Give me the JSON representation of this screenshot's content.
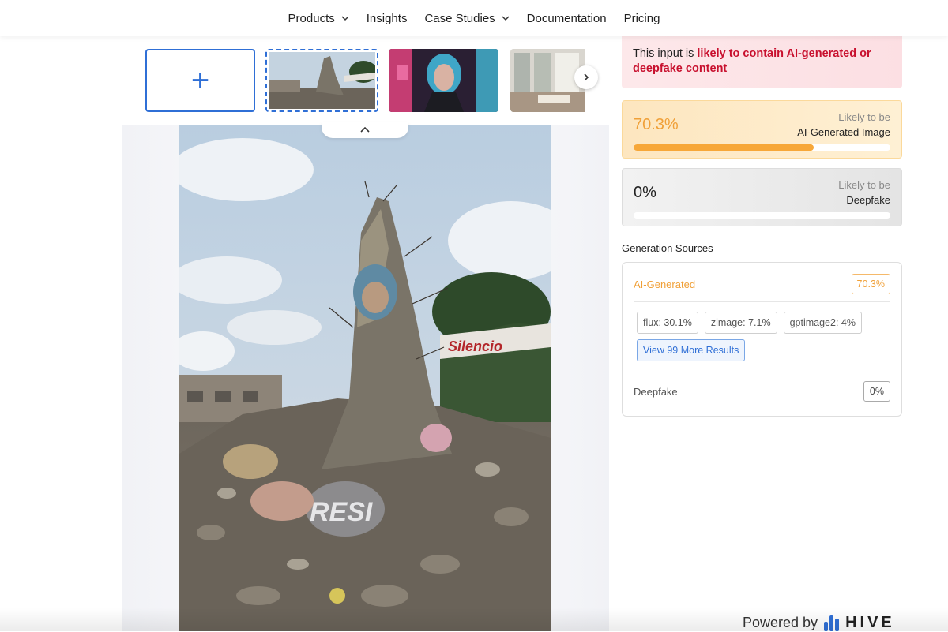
{
  "nav": {
    "items": [
      {
        "label": "Products",
        "has_dropdown": true
      },
      {
        "label": "Insights",
        "has_dropdown": false
      },
      {
        "label": "Case Studies",
        "has_dropdown": true
      },
      {
        "label": "Documentation",
        "has_dropdown": false
      },
      {
        "label": "Pricing",
        "has_dropdown": false
      }
    ]
  },
  "thumbnails": {
    "add_icon": "+",
    "items": [
      "ruined-monument-photo",
      "cyberpunk-portrait-photo",
      "interior-living-room-photo"
    ],
    "next_icon": "chevron-right-icon",
    "collapse_icon": "chevron-up-icon"
  },
  "alert": {
    "prefix": "This input is ",
    "strong": "likely to contain AI-generated or deepfake content"
  },
  "ai_card": {
    "percent": "70.3%",
    "value": 0.703,
    "label_top": "Likely to be",
    "label_bottom": "AI-Generated Image"
  },
  "deepfake_card": {
    "percent": "0%",
    "value": 0.0,
    "label_top": "Likely to be",
    "label_bottom": "Deepfake"
  },
  "sources": {
    "title": "Generation Sources",
    "ai_label": "AI-Generated",
    "ai_value": "70.3%",
    "chips": [
      "flux: 30.1%",
      "zimage: 7.1%",
      "gptimage2: 4%"
    ],
    "more_button": "View 99 More Results",
    "deepfake_label": "Deepfake",
    "deepfake_value": "0%"
  },
  "footer": {
    "powered_by": "Powered by",
    "brand": "HIVE"
  },
  "colors": {
    "accent_blue": "#2f6fd6",
    "ai_orange": "#f0a038",
    "alert_red": "#c8102e"
  }
}
